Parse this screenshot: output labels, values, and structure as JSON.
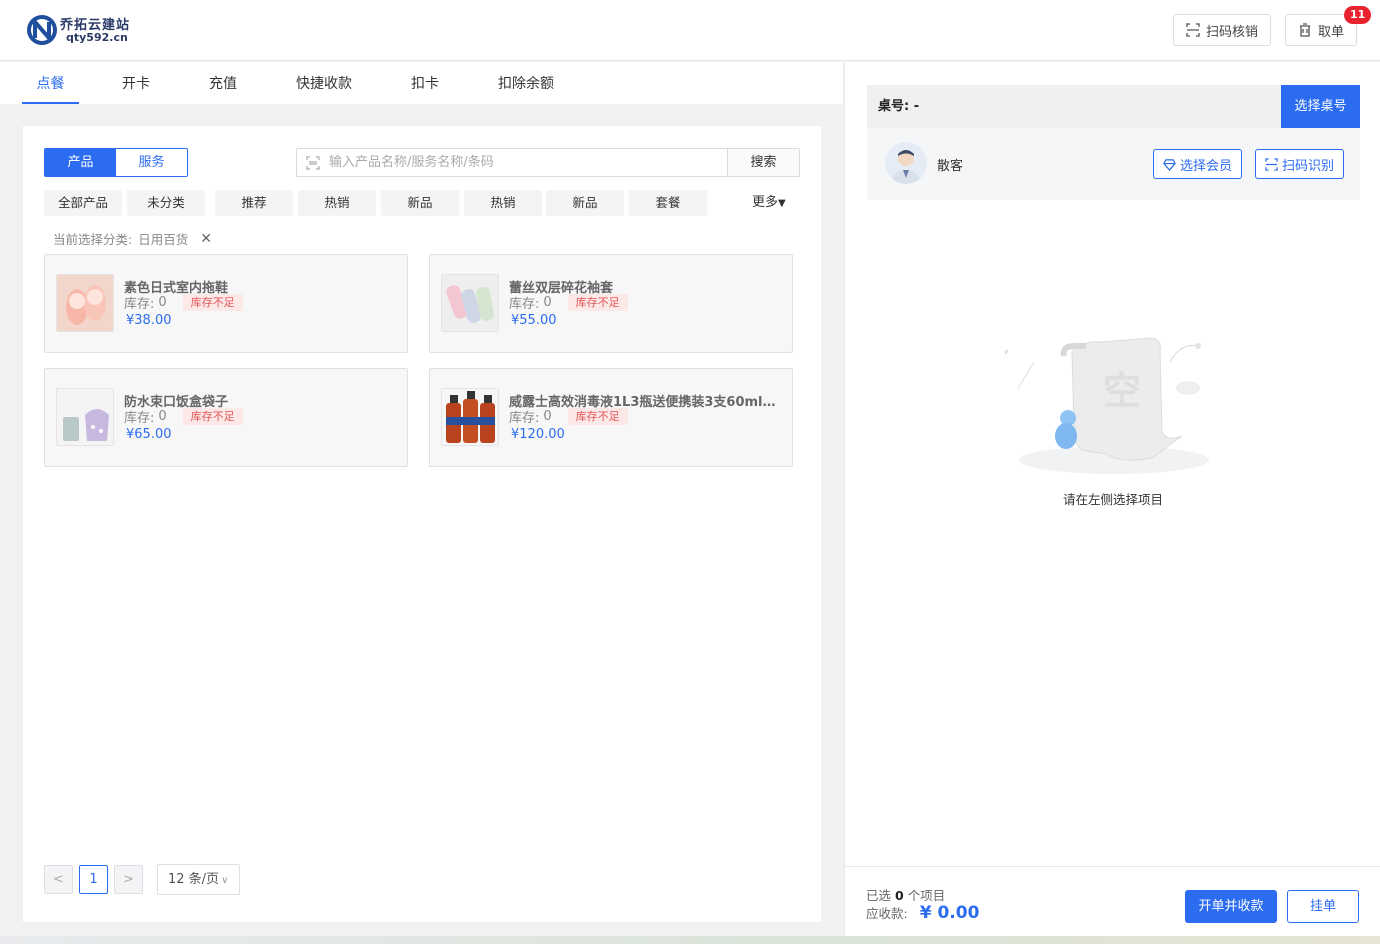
{
  "header": {
    "logo_title": "乔拓云建站",
    "logo_domain": "qty592.cn",
    "scan_verify_label": "扫码核销",
    "take_order_label": "取单",
    "take_order_count": "11"
  },
  "tabs": [
    {
      "label": "点餐",
      "active": true
    },
    {
      "label": "开卡"
    },
    {
      "label": "充值"
    },
    {
      "label": "快捷收款"
    },
    {
      "label": "扣卡"
    },
    {
      "label": "扣除余额"
    }
  ],
  "segment": {
    "product": "产品",
    "service": "服务",
    "selected": "产品"
  },
  "search": {
    "placeholder": "输入产品名称/服务名称/条码",
    "button": "搜索"
  },
  "categories": [
    "全部产品",
    "未分类",
    "推荐",
    "热销",
    "新品",
    "热销",
    "新品",
    "套餐"
  ],
  "more_label": "更多",
  "current_category": {
    "label": "当前选择分类:",
    "value": "日用百货"
  },
  "products": [
    {
      "name": "素色日式室内拖鞋",
      "stock_label": "库存:",
      "stock": "0",
      "tag": "库存不足",
      "price": "¥38.00"
    },
    {
      "name": "蕾丝双层碎花袖套",
      "stock_label": "库存:",
      "stock": "0",
      "tag": "库存不足",
      "price": "¥55.00"
    },
    {
      "name": "防水束口饭盒袋子",
      "stock_label": "库存:",
      "stock": "0",
      "tag": "库存不足",
      "price": "¥65.00"
    },
    {
      "name": "威露士高效消毒液1L3瓶送便携装3支60ml消...",
      "stock_label": "库存:",
      "stock": "0",
      "tag": "库存不足",
      "price": "¥120.00"
    }
  ],
  "pagination": {
    "prev": "<",
    "current": "1",
    "next": ">",
    "page_size": "12 条/页"
  },
  "right": {
    "table_label": "桌号: -",
    "select_table": "选择桌号",
    "guest": "散客",
    "select_member": "选择会员",
    "scan_identify": "扫码识别",
    "empty_glyph": "空",
    "empty_text": "请在左侧选择项目"
  },
  "footer": {
    "selected_prefix": "已选",
    "selected_count": "0",
    "selected_suffix": "个项目",
    "due_label": "应收款:",
    "due_value": "¥ 0.00",
    "pay_button": "开单并收款",
    "hold_button": "挂单"
  },
  "colors": {
    "accent": "#2b6cf0",
    "danger": "#e9232e",
    "warn_tag_bg": "#fde8e8",
    "warn_tag_text": "#e15656"
  }
}
